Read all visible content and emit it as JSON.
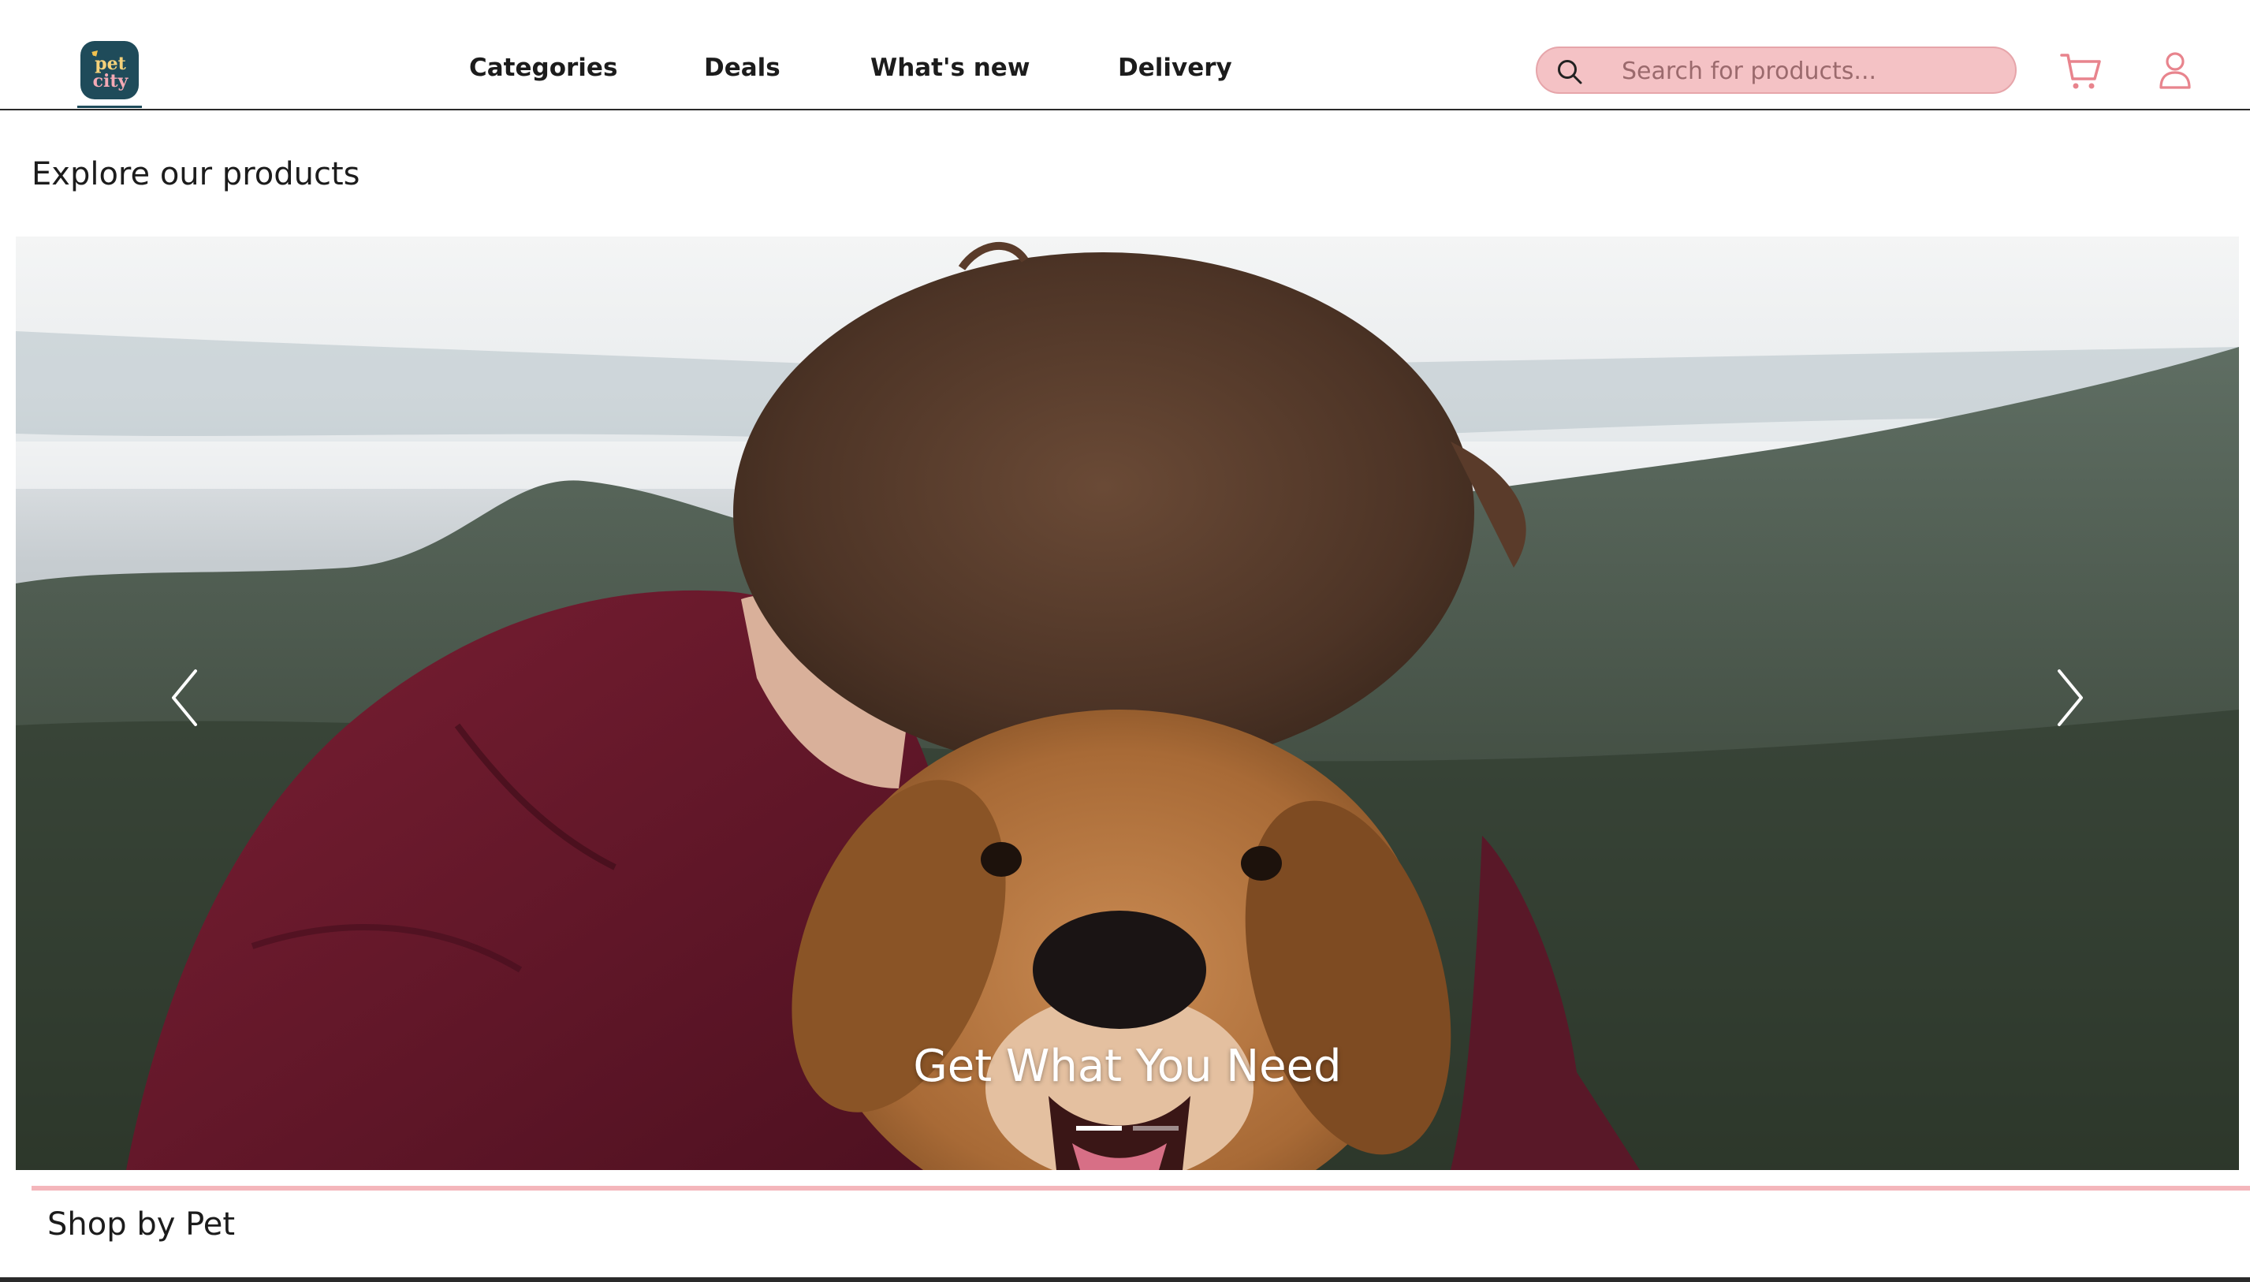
{
  "header": {
    "logo_text_top": "pet",
    "logo_text_bottom": "city",
    "nav": [
      {
        "label": "Categories"
      },
      {
        "label": "Deals"
      },
      {
        "label": "What's new"
      },
      {
        "label": "Delivery"
      }
    ],
    "search": {
      "placeholder": "Search for products...",
      "value": ""
    },
    "icons": {
      "search": "search-icon",
      "cart": "cart-icon",
      "user": "user-icon"
    }
  },
  "main": {
    "section_title": "Explore our products",
    "carousel": {
      "caption": "Get What You Need",
      "slide_count": 2,
      "active_slide": 1,
      "prev_icon": "chevron-left-icon",
      "next_icon": "chevron-right-icon"
    },
    "shop_title": "Shop by Pet"
  },
  "colors": {
    "accent_pink": "#f4c2c5",
    "logo_bg": "#1f4b5a",
    "cart_icon": "#e8848d"
  }
}
